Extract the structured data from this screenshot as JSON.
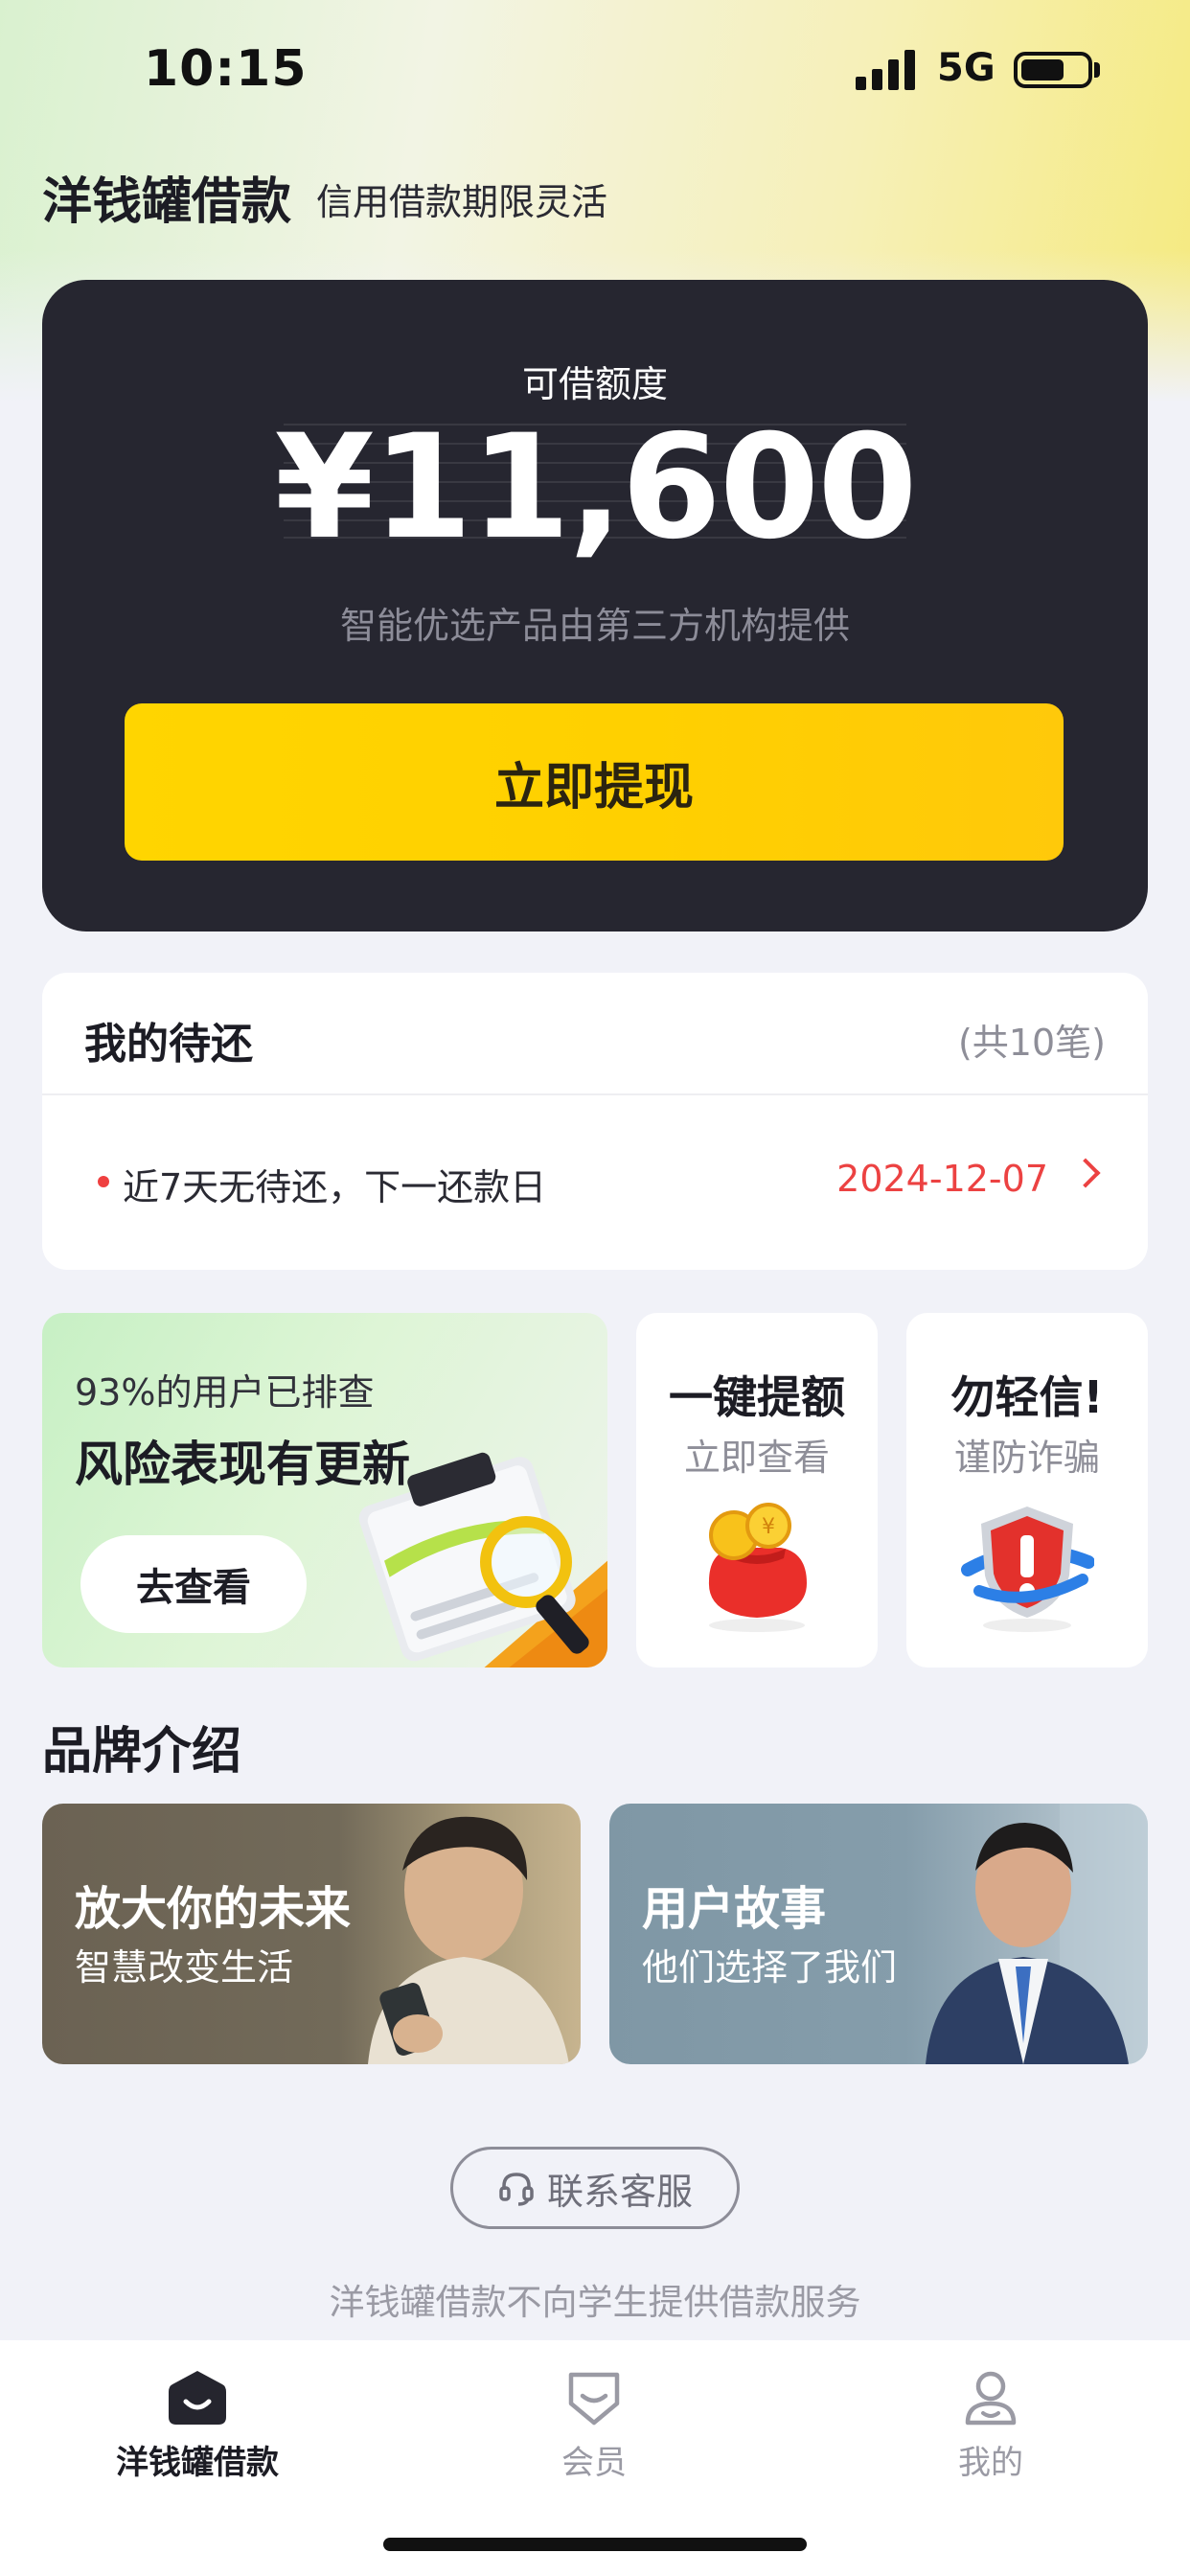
{
  "status_bar": {
    "time": "10:15",
    "network": "5G"
  },
  "header": {
    "title": "洋钱罐借款",
    "slogan": "信用借款期限灵活"
  },
  "credit": {
    "label": "可借额度",
    "amount": "¥11,600",
    "note": "智能优选产品由第三方机构提供",
    "withdraw_label": "立即提现"
  },
  "repayment": {
    "title": "我的待还",
    "count": "(共10笔)",
    "message": "近7天无待还，下一还款日",
    "next_date": "2024-12-07"
  },
  "promos": {
    "risk": {
      "subtitle": "93%的用户已排查",
      "title": "风险表现有更新",
      "button": "去查看"
    },
    "quota": {
      "title": "一键提额",
      "subtitle": "立即查看",
      "icon": "money-bag-icon"
    },
    "fraud": {
      "title": "勿轻信!",
      "subtitle": "谨防诈骗",
      "icon": "shield-warning-icon"
    }
  },
  "brand": {
    "heading": "品牌介绍",
    "cards": [
      {
        "title": "放大你的未来",
        "subtitle": "智慧改变生活"
      },
      {
        "title": "用户故事",
        "subtitle": "他们选择了我们"
      }
    ]
  },
  "service": {
    "label": "联系客服",
    "disclaimer": "洋钱罐借款不向学生提供借款服务"
  },
  "tabbar": {
    "items": [
      {
        "label": "洋钱罐借款",
        "icon": "home-bag-icon",
        "active": true
      },
      {
        "label": "会员",
        "icon": "member-icon",
        "active": false
      },
      {
        "label": "我的",
        "icon": "profile-icon",
        "active": false
      }
    ]
  },
  "colors": {
    "accent": "#FFD400",
    "dark_card": "#262630",
    "alert_red": "#EC4242"
  }
}
